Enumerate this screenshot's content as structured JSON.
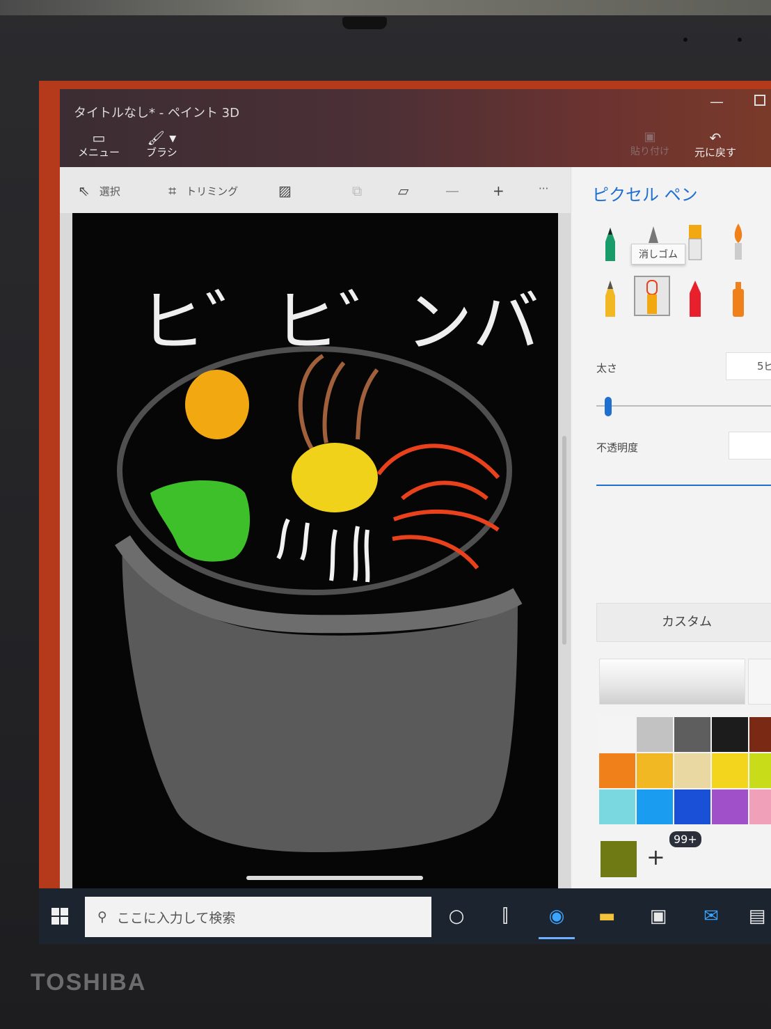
{
  "window": {
    "title": "タイトルなし* - ペイント 3D",
    "menu_label": "メニュー",
    "brush_label": "ブラシ",
    "sticker_label": "貼り付け",
    "undo_label": "元に戻す"
  },
  "toolbar": {
    "select_label": "選択",
    "crop_label": "トリミング",
    "more_label": "···"
  },
  "canvas": {
    "drawn_text": "ヒ゛ヒ゛ンバ"
  },
  "panel": {
    "title": "ピクセル ペン",
    "tooltip": "消しゴム",
    "thickness_label": "太さ",
    "thickness_value": "5ピ",
    "opacity_label": "不透明度",
    "custom_label": "カスタム",
    "palette": [
      "#f4f4f4",
      "#c2c2c2",
      "#5e5e5e",
      "#1c1c1c",
      "#7a2a14",
      "#f0801a",
      "#f2b823",
      "#ead8a2",
      "#f2d51c",
      "#c8dc1a",
      "#7ad8e0",
      "#1a9cf0",
      "#1a4fd8",
      "#a050c8",
      "#f0a0b8"
    ],
    "custom_color": "#6f7a14",
    "add_label": "+"
  },
  "taskbar": {
    "search_placeholder": "ここに入力して検索",
    "badge": "99+"
  },
  "bezel": {
    "brand": "TOSHIBA"
  }
}
